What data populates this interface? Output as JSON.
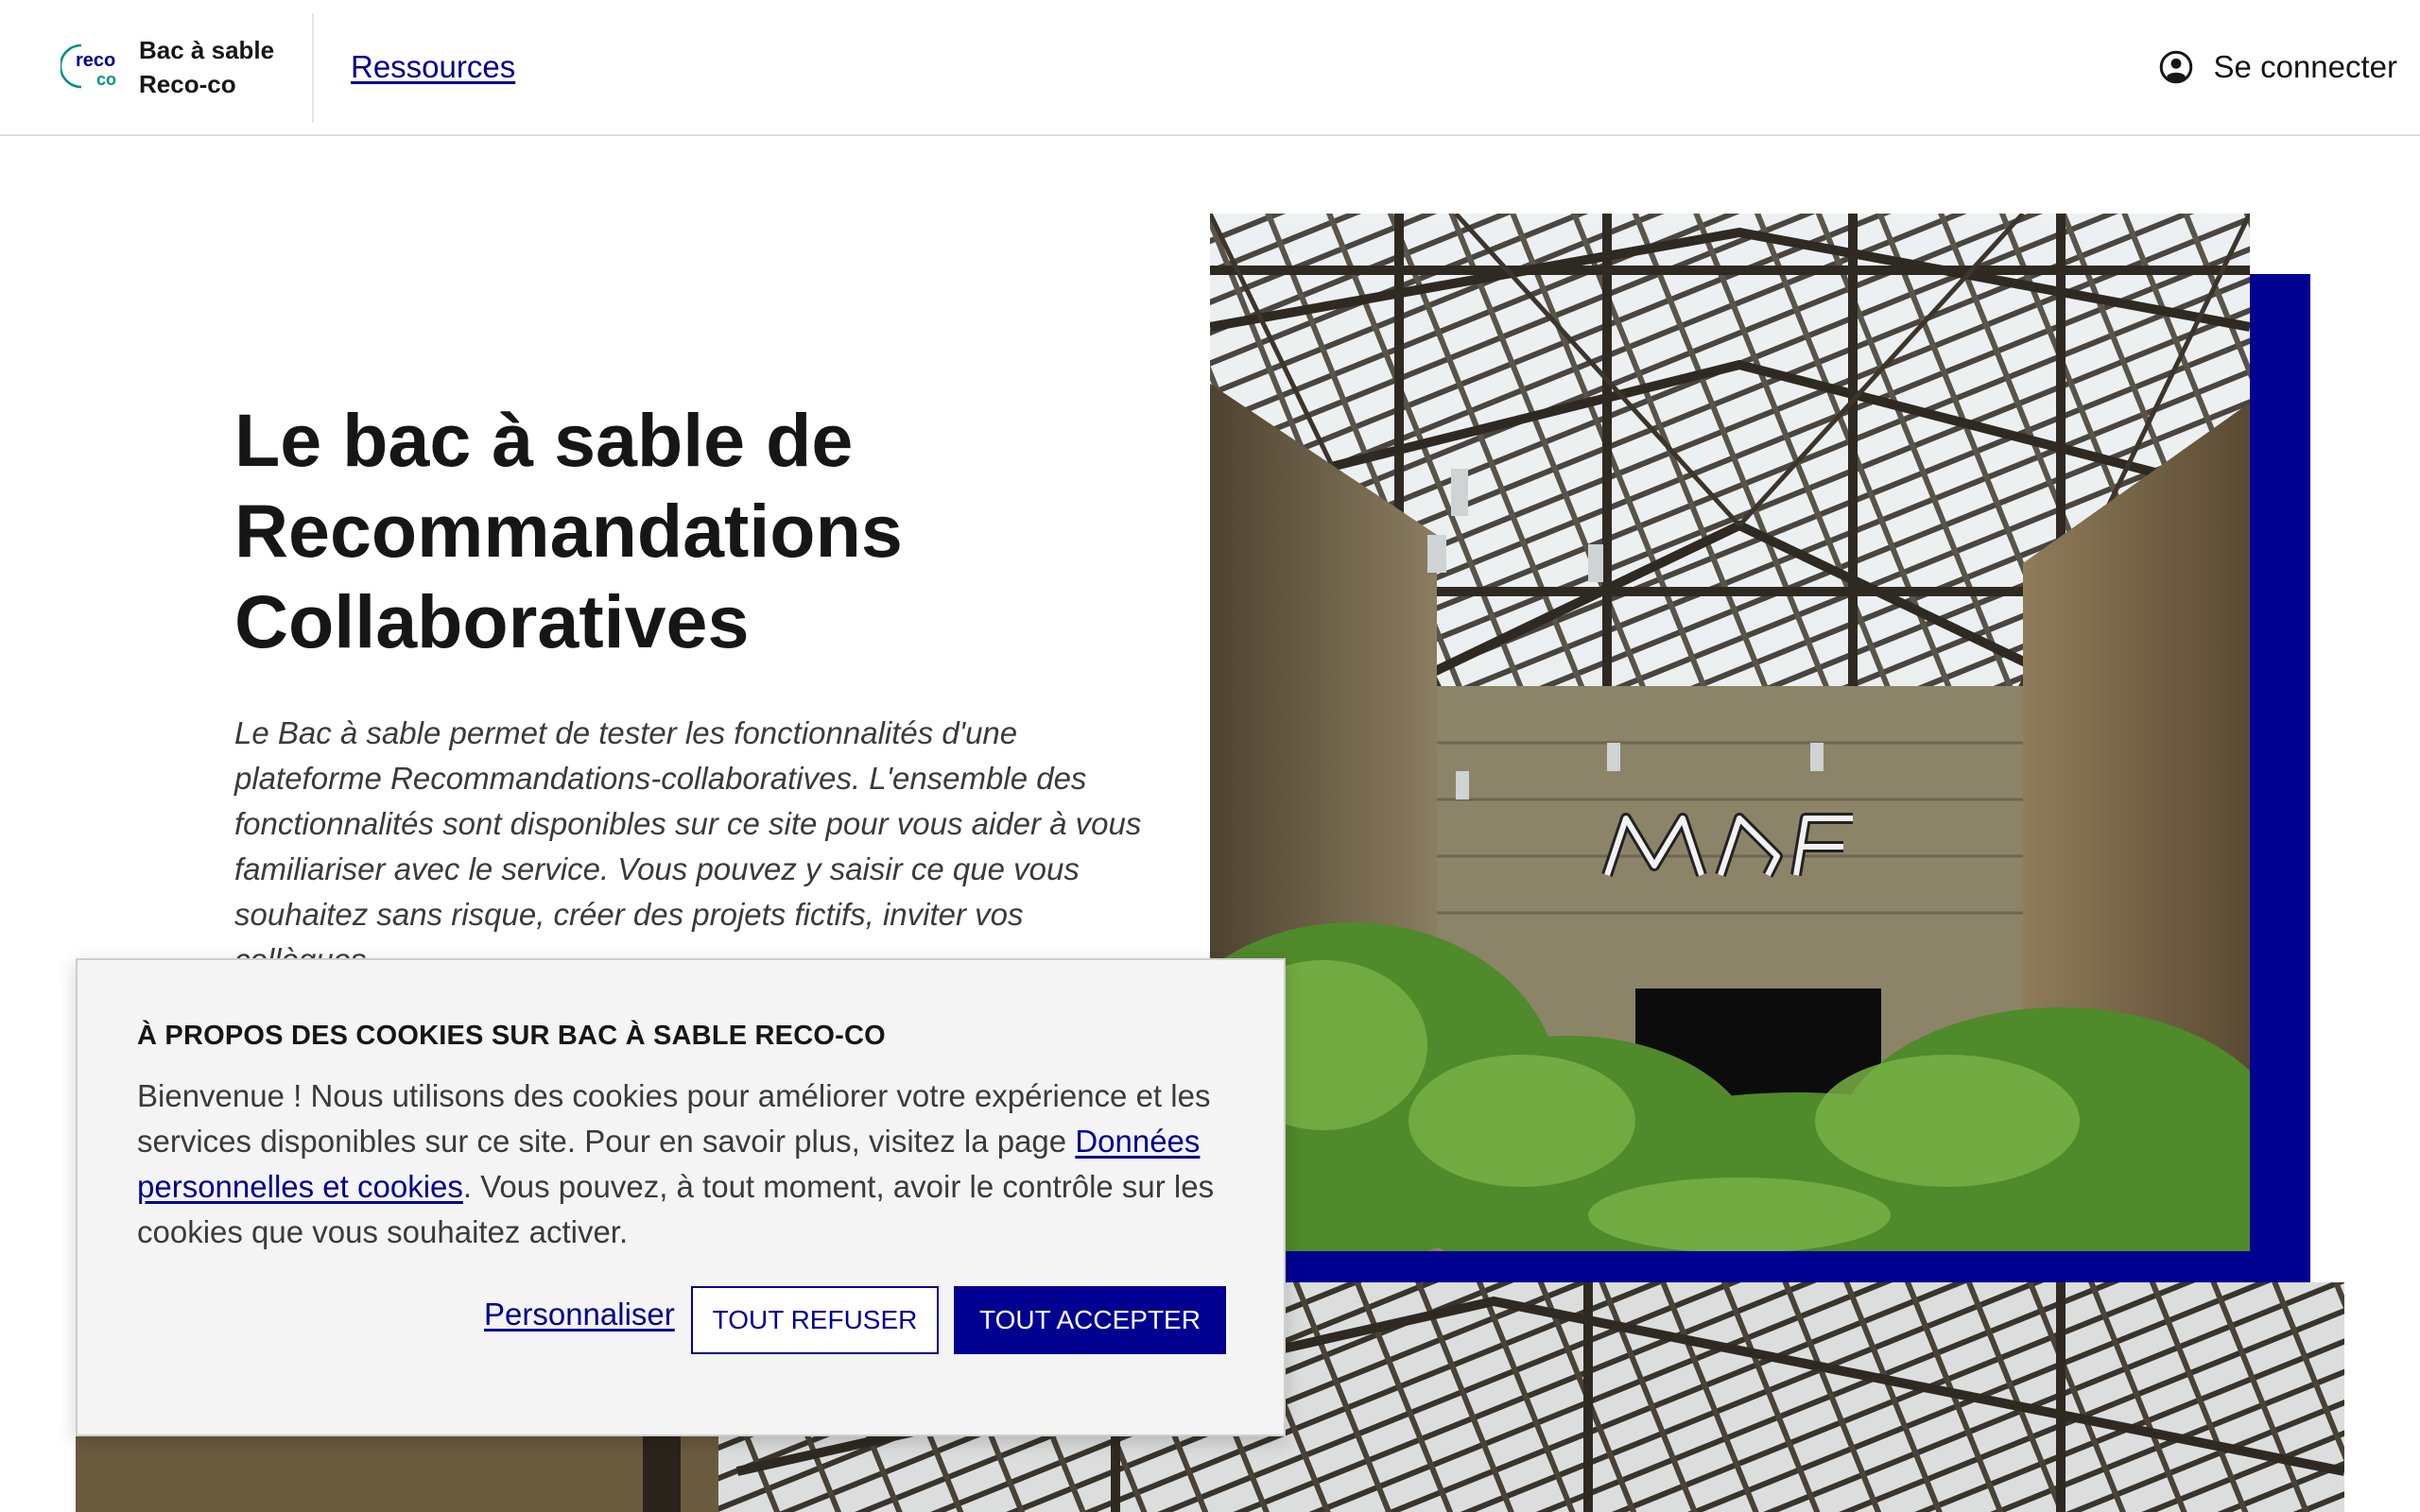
{
  "header": {
    "logo_text_top": "reco",
    "logo_text_bottom": "co",
    "brand_line1": "Bac à sable",
    "brand_line2": "Reco-co",
    "nav_link": "Ressources",
    "login_label": "Se connecter",
    "login_icon": "user-circle-icon"
  },
  "hero": {
    "title_line1": "Le bac à sable de",
    "title_line2": "Recommandations",
    "title_line3": "Collaboratives",
    "description": "Le Bac à sable permet de tester les fonctionnalités d'une plateforme Recommandations-collaboratives. L'ensemble des fonctionnalités sont disponibles sur ce site pour vous aider à vous familiariser avec le service. Vous pouvez y saisir ce que vous souhaitez sans risque, créer des projets fictifs, inviter vos collègues..."
  },
  "cookie_banner": {
    "title": "À PROPOS DES COOKIES SUR BAC À SABLE RECO-CO",
    "text_before_link": "Bienvenue ! Nous utilisons des cookies pour améliorer votre expérience et les services disponibles sur ce site. Pour en savoir plus, visitez la page ",
    "link_text": "Données personnelles et cookies",
    "text_after_link": ". Vous pouvez, à tout moment, avoir le contrôle sur les cookies que vous souhaitez activer.",
    "personalize_label": "Personnaliser",
    "refuse_label": "TOUT REFUSER",
    "accept_label": "TOUT ACCEPTER"
  },
  "colors": {
    "accent": "#000091",
    "text": "#161616",
    "banner_background": "#f4f4f4"
  }
}
